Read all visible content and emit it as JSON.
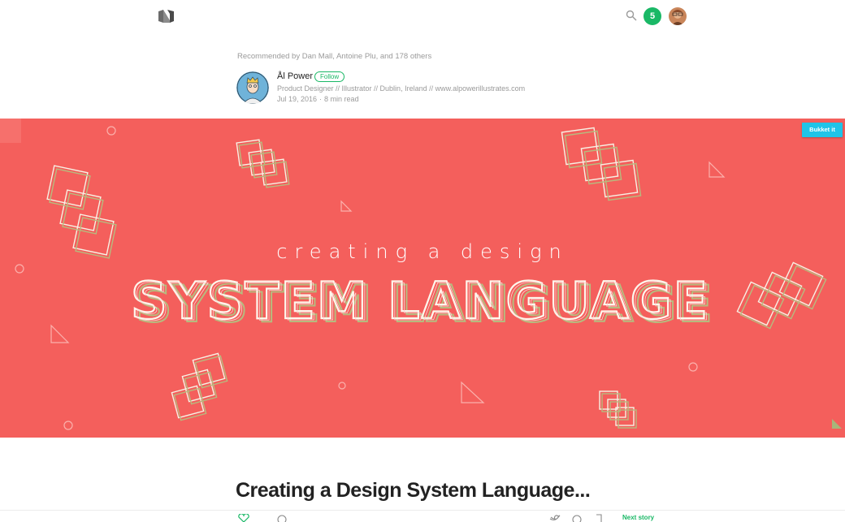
{
  "topbar": {
    "logo_icon": "medium-logo-icon",
    "search_icon": "search-icon",
    "notification_count": "5",
    "user_avatar_icon": "user-avatar-icon"
  },
  "post_header": {
    "recommended_by": "Recommended by Dan Mall, Antoine Plu, and 178 others",
    "author_name": "Ål Power",
    "follow_label": "Follow",
    "author_bio": "Product Designer // Illustrator // Dublin, Ireland // www.alpowerillustrates.com",
    "date": "Jul 19, 2016",
    "read_time": "8 min read"
  },
  "hero": {
    "subtitle": "creating a design",
    "title": "SYSTEM LANGUAGE",
    "background_color": "#f45f5c",
    "bukket_label": "Bukket it"
  },
  "article": {
    "title": "Creating a Design System Language..."
  },
  "action_bar": {
    "next_story_label": "Next story",
    "accent_color": "#1ab866"
  }
}
